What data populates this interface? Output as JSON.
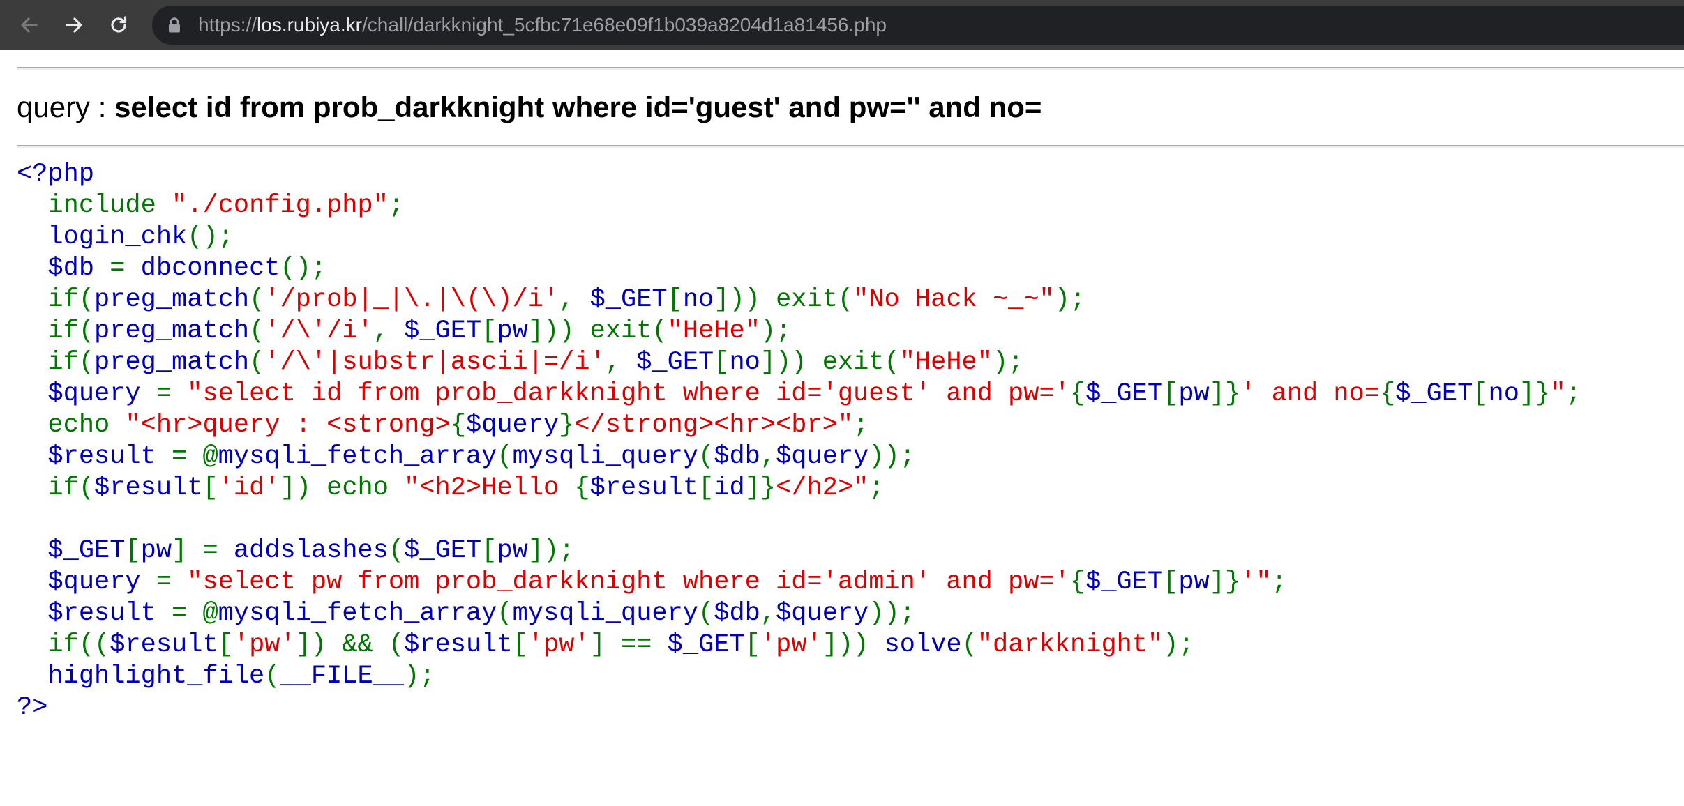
{
  "browser": {
    "url_scheme": "https://",
    "url_host": "los.rubiya.kr",
    "url_path": "/chall/darkknight_5cfbc71e68e09f1b039a8204d1a81456.php",
    "icons": {
      "back": "arrow-left-icon",
      "forward": "arrow-right-icon",
      "reload": "reload-icon",
      "lock": "lock-icon"
    }
  },
  "page": {
    "query_label": "query : ",
    "query_sql": "select id from prob_darkknight where id='guest' and pw='' and no="
  },
  "code_colors": {
    "default": "#0000BB",
    "keyword": "#007700",
    "string": "#DD0000"
  },
  "code_lines": [
    [
      [
        "d",
        "<?php"
      ]
    ],
    [
      [
        "k",
        "  include "
      ],
      [
        "s",
        "\"./config.php\""
      ],
      [
        "k",
        ";"
      ]
    ],
    [
      [
        "d",
        "  login_chk"
      ],
      [
        "k",
        "();"
      ]
    ],
    [
      [
        "d",
        "  $db "
      ],
      [
        "k",
        "= "
      ],
      [
        "d",
        "dbconnect"
      ],
      [
        "k",
        "();"
      ]
    ],
    [
      [
        "k",
        "  if("
      ],
      [
        "d",
        "preg_match"
      ],
      [
        "k",
        "("
      ],
      [
        "s",
        "'/prob|_|\\.|\\(\\)/i'"
      ],
      [
        "k",
        ", "
      ],
      [
        "d",
        "$_GET"
      ],
      [
        "k",
        "["
      ],
      [
        "d",
        "no"
      ],
      [
        "k",
        "])) exit("
      ],
      [
        "s",
        "\"No Hack ~_~\""
      ],
      [
        "k",
        ");"
      ]
    ],
    [
      [
        "k",
        "  if("
      ],
      [
        "d",
        "preg_match"
      ],
      [
        "k",
        "("
      ],
      [
        "s",
        "'/\\'/i'"
      ],
      [
        "k",
        ", "
      ],
      [
        "d",
        "$_GET"
      ],
      [
        "k",
        "["
      ],
      [
        "d",
        "pw"
      ],
      [
        "k",
        "])) exit("
      ],
      [
        "s",
        "\"HeHe\""
      ],
      [
        "k",
        ");"
      ]
    ],
    [
      [
        "k",
        "  if("
      ],
      [
        "d",
        "preg_match"
      ],
      [
        "k",
        "("
      ],
      [
        "s",
        "'/\\'|substr|ascii|=/i'"
      ],
      [
        "k",
        ", "
      ],
      [
        "d",
        "$_GET"
      ],
      [
        "k",
        "["
      ],
      [
        "d",
        "no"
      ],
      [
        "k",
        "])) exit("
      ],
      [
        "s",
        "\"HeHe\""
      ],
      [
        "k",
        ");"
      ]
    ],
    [
      [
        "d",
        "  $query "
      ],
      [
        "k",
        "= "
      ],
      [
        "s",
        "\"select id from prob_darkknight where id='guest' and pw='"
      ],
      [
        "k",
        "{"
      ],
      [
        "d",
        "$_GET"
      ],
      [
        "k",
        "["
      ],
      [
        "d",
        "pw"
      ],
      [
        "k",
        "]}"
      ],
      [
        "s",
        "' and no="
      ],
      [
        "k",
        "{"
      ],
      [
        "d",
        "$_GET"
      ],
      [
        "k",
        "["
      ],
      [
        "d",
        "no"
      ],
      [
        "k",
        "]}"
      ],
      [
        "s",
        "\""
      ],
      [
        "k",
        ";"
      ]
    ],
    [
      [
        "k",
        "  echo "
      ],
      [
        "s",
        "\"<hr>query : <strong>"
      ],
      [
        "k",
        "{"
      ],
      [
        "d",
        "$query"
      ],
      [
        "k",
        "}"
      ],
      [
        "s",
        "</strong><hr><br>\""
      ],
      [
        "k",
        ";"
      ]
    ],
    [
      [
        "d",
        "  $result "
      ],
      [
        "k",
        "= @"
      ],
      [
        "d",
        "mysqli_fetch_array"
      ],
      [
        "k",
        "("
      ],
      [
        "d",
        "mysqli_query"
      ],
      [
        "k",
        "("
      ],
      [
        "d",
        "$db"
      ],
      [
        "k",
        ","
      ],
      [
        "d",
        "$query"
      ],
      [
        "k",
        "));"
      ]
    ],
    [
      [
        "k",
        "  if("
      ],
      [
        "d",
        "$result"
      ],
      [
        "k",
        "["
      ],
      [
        "s",
        "'id'"
      ],
      [
        "k",
        "]) echo "
      ],
      [
        "s",
        "\"<h2>Hello "
      ],
      [
        "k",
        "{"
      ],
      [
        "d",
        "$result"
      ],
      [
        "k",
        "["
      ],
      [
        "d",
        "id"
      ],
      [
        "k",
        "]}"
      ],
      [
        "s",
        "</h2>\""
      ],
      [
        "k",
        ";"
      ]
    ],
    [],
    [
      [
        "d",
        "  $_GET"
      ],
      [
        "k",
        "["
      ],
      [
        "d",
        "pw"
      ],
      [
        "k",
        "] = "
      ],
      [
        "d",
        "addslashes"
      ],
      [
        "k",
        "("
      ],
      [
        "d",
        "$_GET"
      ],
      [
        "k",
        "["
      ],
      [
        "d",
        "pw"
      ],
      [
        "k",
        "]);"
      ]
    ],
    [
      [
        "d",
        "  $query "
      ],
      [
        "k",
        "= "
      ],
      [
        "s",
        "\"select pw from prob_darkknight where id='admin' and pw='"
      ],
      [
        "k",
        "{"
      ],
      [
        "d",
        "$_GET"
      ],
      [
        "k",
        "["
      ],
      [
        "d",
        "pw"
      ],
      [
        "k",
        "]}"
      ],
      [
        "s",
        "'\""
      ],
      [
        "k",
        ";"
      ]
    ],
    [
      [
        "d",
        "  $result "
      ],
      [
        "k",
        "= @"
      ],
      [
        "d",
        "mysqli_fetch_array"
      ],
      [
        "k",
        "("
      ],
      [
        "d",
        "mysqli_query"
      ],
      [
        "k",
        "("
      ],
      [
        "d",
        "$db"
      ],
      [
        "k",
        ","
      ],
      [
        "d",
        "$query"
      ],
      [
        "k",
        "));"
      ]
    ],
    [
      [
        "k",
        "  if(("
      ],
      [
        "d",
        "$result"
      ],
      [
        "k",
        "["
      ],
      [
        "s",
        "'pw'"
      ],
      [
        "k",
        "]) && ("
      ],
      [
        "d",
        "$result"
      ],
      [
        "k",
        "["
      ],
      [
        "s",
        "'pw'"
      ],
      [
        "k",
        "] == "
      ],
      [
        "d",
        "$_GET"
      ],
      [
        "k",
        "["
      ],
      [
        "s",
        "'pw'"
      ],
      [
        "k",
        "])) "
      ],
      [
        "d",
        "solve"
      ],
      [
        "k",
        "("
      ],
      [
        "s",
        "\"darkknight\""
      ],
      [
        "k",
        ");"
      ]
    ],
    [
      [
        "d",
        "  highlight_file"
      ],
      [
        "k",
        "("
      ],
      [
        "d",
        "__FILE__"
      ],
      [
        "k",
        ");"
      ]
    ],
    [
      [
        "d",
        "?>"
      ]
    ]
  ]
}
